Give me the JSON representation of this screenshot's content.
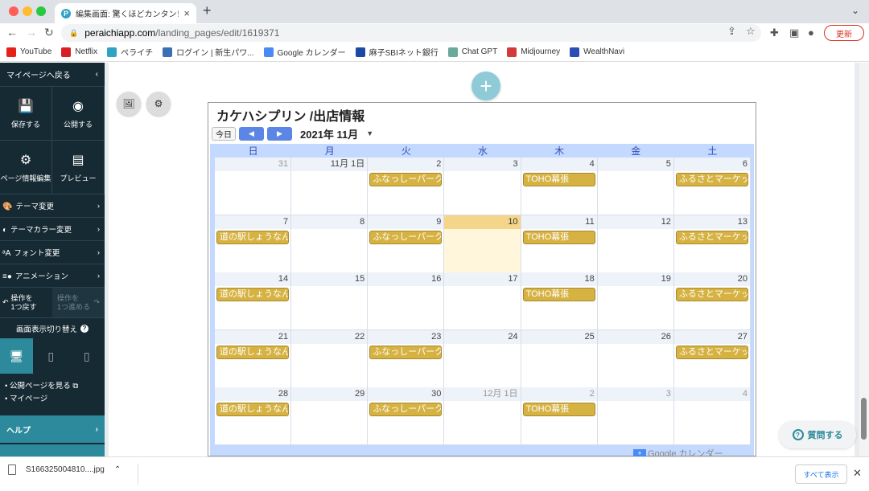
{
  "browser": {
    "tab_title": "編集画面: 驚くほどカンタン！無料",
    "tab_favicon": "P",
    "url_host": "peraichiapp.com",
    "url_path": "/landing_pages/edit/1619371",
    "update_label": "更新",
    "new_tab": "+"
  },
  "bookmarks": [
    {
      "label": "YouTube",
      "icon": "youtube-icon",
      "color": "#e62117"
    },
    {
      "label": "Netflix",
      "icon": "netflix-icon",
      "color": "#d81f26"
    },
    {
      "label": "ペライチ",
      "icon": "peraichi-icon",
      "color": "#2fa3c4"
    },
    {
      "label": "ログイン | 新生パワ...",
      "icon": "shinsei-icon",
      "color": "#3a6fb5"
    },
    {
      "label": "Google カレンダー",
      "icon": "google-calendar-icon",
      "color": "#4a8af4"
    },
    {
      "label": "麻子SBIネット銀行",
      "icon": "sbi-icon",
      "color": "#1c4aa3"
    },
    {
      "label": "Chat GPT",
      "icon": "chatgpt-icon",
      "color": "#6aa99b"
    },
    {
      "label": "Midjourney",
      "icon": "midjourney-icon",
      "color": "#d53a3a"
    },
    {
      "label": "WealthNavi",
      "icon": "wealthnavi-icon",
      "color": "#2c4db3"
    }
  ],
  "sidebar": {
    "back_label": "マイページへ戻る",
    "save_label": "保存する",
    "publish_label": "公開する",
    "page_info_label": "ページ情報編集",
    "preview_label": "プレビュー",
    "menu": [
      {
        "label": "テーマ変更",
        "icon": "palette-icon"
      },
      {
        "label": "テーマカラー変更",
        "icon": "color-icon"
      },
      {
        "label": "フォント変更",
        "icon": "font-icon"
      },
      {
        "label": "アニメーション",
        "icon": "animation-icon"
      }
    ],
    "undo_label_1": "操作を",
    "undo_label_2": "1つ戻す",
    "redo_label_1": "操作を",
    "redo_label_2": "1つ進める",
    "view_switch_label": "画面表示切り替え",
    "links": [
      "公開ページを見る",
      "マイページ"
    ],
    "help_label": "ヘルプ"
  },
  "calendar": {
    "title": "カケハシプリン /出店情報",
    "today_label": "今日",
    "month_label": "2021年 11月",
    "days_of_week": [
      "日",
      "月",
      "火",
      "水",
      "木",
      "金",
      "土"
    ],
    "weeks": [
      [
        {
          "num": "31",
          "other": true
        },
        {
          "num": "11月 1日"
        },
        {
          "num": "2",
          "event": "ふなっしーパーク"
        },
        {
          "num": "3"
        },
        {
          "num": "4",
          "event": "TOHO幕張"
        },
        {
          "num": "5"
        },
        {
          "num": "6",
          "event": "ふるさとマーケット"
        }
      ],
      [
        {
          "num": "7",
          "event": "道の駅しょうなん"
        },
        {
          "num": "8"
        },
        {
          "num": "9",
          "event": "ふなっしーパーク"
        },
        {
          "num": "10",
          "today": true
        },
        {
          "num": "11",
          "event": "TOHO幕張"
        },
        {
          "num": "12"
        },
        {
          "num": "13",
          "event": "ふるさとマーケット"
        }
      ],
      [
        {
          "num": "14",
          "event": "道の駅しょうなん"
        },
        {
          "num": "15"
        },
        {
          "num": "16"
        },
        {
          "num": "17"
        },
        {
          "num": "18",
          "event": "TOHO幕張"
        },
        {
          "num": "19"
        },
        {
          "num": "20",
          "event": "ふるさとマーケット"
        }
      ],
      [
        {
          "num": "21",
          "event": "道の駅しょうなん"
        },
        {
          "num": "22"
        },
        {
          "num": "23",
          "event": "ふなっしーパーク"
        },
        {
          "num": "24"
        },
        {
          "num": "25"
        },
        {
          "num": "26"
        },
        {
          "num": "27",
          "event": "ふるさとマーケット"
        }
      ],
      [
        {
          "num": "28",
          "event": "道の駅しょうなん"
        },
        {
          "num": "29"
        },
        {
          "num": "30",
          "event": "ふなっしーパーク"
        },
        {
          "num": "12月 1日",
          "other": true
        },
        {
          "num": "2",
          "other": true,
          "event": "TOHO幕張"
        },
        {
          "num": "3",
          "other": true
        },
        {
          "num": "4",
          "other": true
        }
      ]
    ],
    "footer_logo": "Google カレンダー"
  },
  "ask_button_label": "質問する",
  "download": {
    "filename": "S166325004810....jpg",
    "show_all_label": "すべて表示"
  }
}
